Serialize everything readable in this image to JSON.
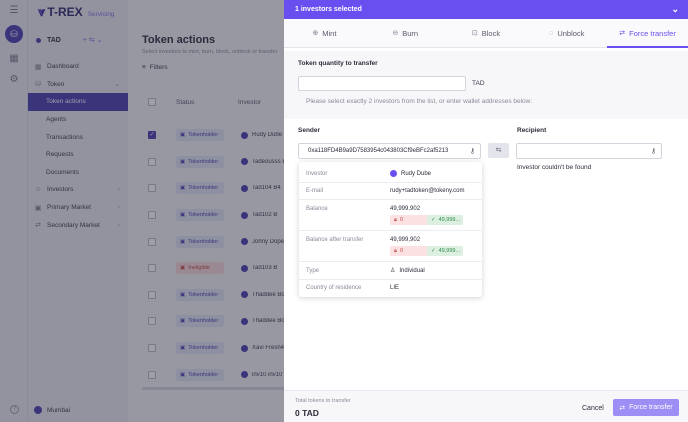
{
  "app": {
    "brand": "T-REX",
    "brand_sub": "Servicing"
  },
  "token_selector": {
    "symbol": "TAD",
    "extra": "+ ⇆ ⌄"
  },
  "sidebar": {
    "items": [
      {
        "label": "Dashboard",
        "icon": "grid-icon"
      },
      {
        "label": "Token",
        "icon": "token-icon",
        "expandable": true
      },
      {
        "label": "Token actions",
        "sub": true,
        "active": true
      },
      {
        "label": "Agents",
        "sub": true
      },
      {
        "label": "Transactions",
        "sub": true
      },
      {
        "label": "Requests",
        "sub": true
      },
      {
        "label": "Documents",
        "sub": true
      },
      {
        "label": "Investors",
        "icon": "users-icon",
        "expandable": true
      },
      {
        "label": "Primary Market",
        "icon": "primary-market-icon",
        "expandable": true
      },
      {
        "label": "Secondary Market",
        "icon": "secondary-market-icon",
        "expandable": true
      }
    ],
    "user": "Mumbai"
  },
  "main": {
    "title": "Token actions",
    "lead": "Select investors to mint, burn, block, unblock or transfer",
    "filters_label": "Filters",
    "columns": {
      "status": "Status",
      "investor": "Investor"
    },
    "rows": [
      {
        "status": "Tokenholder",
        "name": "Rudy Dube",
        "checked": true
      },
      {
        "status": "Tokenholder",
        "name": "Tadeousss Bou",
        "checked": false
      },
      {
        "status": "Tokenholder",
        "name": "Tad104 B4",
        "checked": false
      },
      {
        "status": "Tokenholder",
        "name": "Tad102 B",
        "checked": false
      },
      {
        "status": "Tokenholder",
        "name": "Johny Dope",
        "checked": false
      },
      {
        "status": "Ineligible",
        "name": "Tad103 B",
        "checked": false,
        "warn": true
      },
      {
        "status": "Tokenholder",
        "name": "Thaddee Bouss",
        "checked": false
      },
      {
        "status": "Tokenholder",
        "name": "Thaddee Bouss",
        "checked": false
      },
      {
        "status": "Tokenholder",
        "name": "Xavi Fresh4",
        "checked": false
      },
      {
        "status": "Tokenholder",
        "name": "inv10 inv10",
        "checked": false
      }
    ]
  },
  "drawer": {
    "header": "1 investors selected",
    "tabs": [
      {
        "label": "Mint",
        "icon": "plus-circle-icon"
      },
      {
        "label": "Burn",
        "icon": "minus-circle-icon"
      },
      {
        "label": "Block",
        "icon": "lock-icon"
      },
      {
        "label": "Unblock",
        "icon": "unlock-icon"
      },
      {
        "label": "Force transfer",
        "icon": "transfer-icon",
        "active": true
      }
    ],
    "quantity_label": "Token quantity to transfer",
    "quantity_value": "",
    "quantity_unit": "TAD",
    "hint": "Please select exactly 2 investors from the list, or enter wallet addresses below:",
    "sender_label": "Sender",
    "recipient_label": "Recipient",
    "sender_address": "0xa118FD4B9a9D7583954c043803Cf9eBFc2af5213",
    "recipient_address": "",
    "recipient_message": "Investor couldn't be found",
    "sender_card": {
      "investor_label": "Investor",
      "investor_value": "Rudy Dube",
      "email_label": "E-mail",
      "email_value": "rudy+tadtoken@tokeny.com",
      "balance_label": "Balance",
      "balance_value": "49,999,902",
      "balance_locked": "0",
      "balance_free": "49,999...",
      "after_label": "Balance after transfer",
      "after_value": "49,999,902",
      "after_locked": "0",
      "after_free": "49,999...",
      "type_label": "Type",
      "type_value": "Individual",
      "country_label": "Country of residence",
      "country_value": "LIE"
    },
    "footer": {
      "total_label": "Total tokens to transfer",
      "total_value": "0 TAD",
      "cancel_label": "Cancel",
      "submit_label": "Force transfer"
    }
  },
  "colors": {
    "accent": "#6a4ff0",
    "brand": "#4a3fb0",
    "submit_disabled": "#9c8ef5"
  }
}
